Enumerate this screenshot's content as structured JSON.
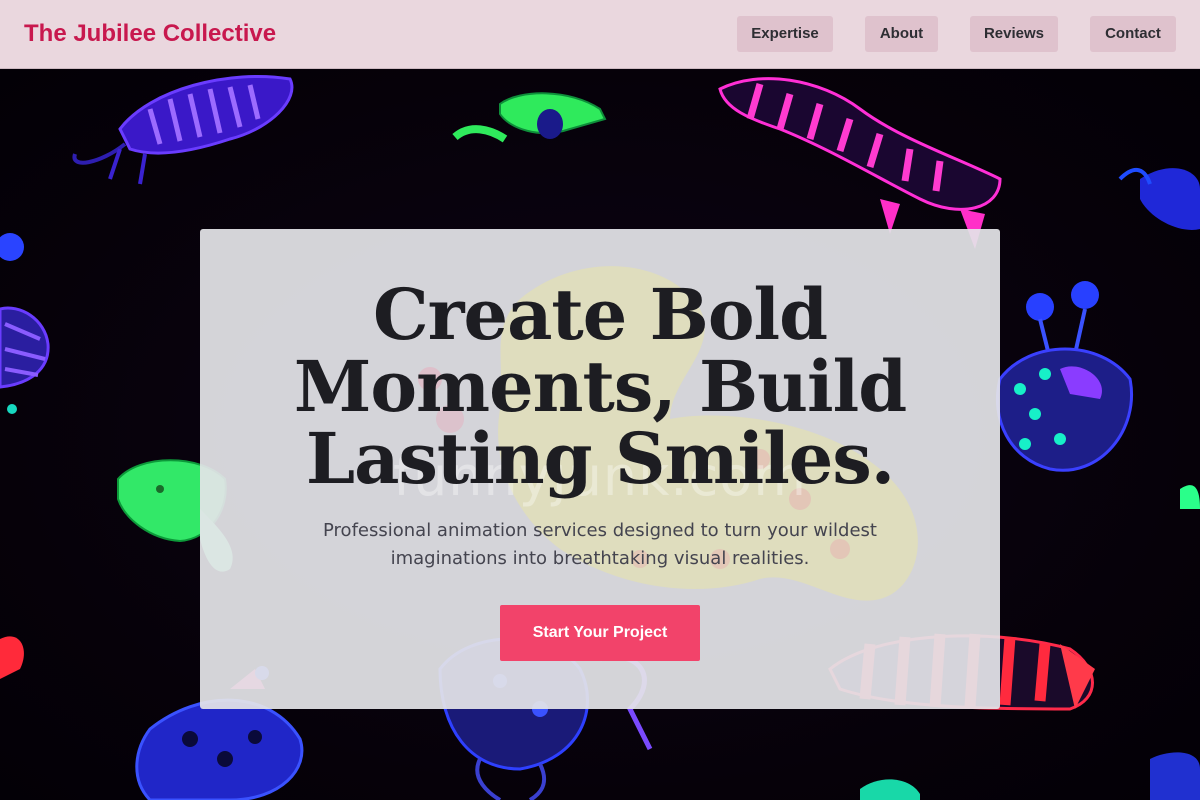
{
  "header": {
    "brand": "The Jubilee Collective",
    "nav": [
      {
        "label": "Expertise"
      },
      {
        "label": "About"
      },
      {
        "label": "Reviews"
      },
      {
        "label": "Contact"
      }
    ]
  },
  "hero": {
    "title": "Create Bold Moments, Build Lasting Smiles.",
    "subtitle": "Professional animation services designed to turn your wildest imaginations into breathtaking visual realities.",
    "cta_label": "Start Your Project",
    "watermark": "funnyjunk.com",
    "background_image": "neon-creatures-doodle-illustration"
  },
  "colors": {
    "brand": "#c8184e",
    "nav_bg": "#ead7de",
    "nav_button_bg": "#dfc2cd",
    "cta": "#f2436a",
    "card_bg": "#e4e4e8"
  }
}
